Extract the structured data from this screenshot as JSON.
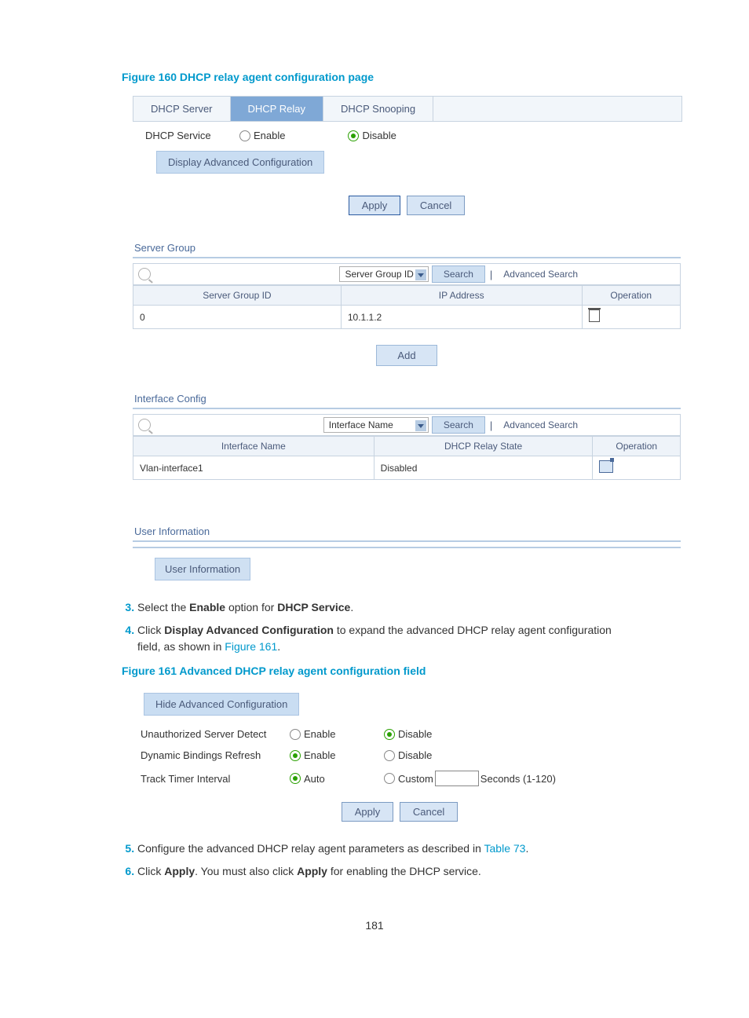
{
  "figure160_caption": "Figure 160 DHCP relay agent configuration page",
  "tabs": {
    "server": "DHCP Server",
    "relay": "DHCP Relay",
    "snooping": "DHCP Snooping"
  },
  "service": {
    "label": "DHCP Service",
    "enable": "Enable",
    "disable": "Disable"
  },
  "display_adv_btn": "Display Advanced Configuration",
  "apply": "Apply",
  "cancel": "Cancel",
  "server_group": {
    "title": "Server Group",
    "dropdown": "Server Group ID",
    "search": "Search",
    "advanced": "Advanced Search",
    "cols": {
      "id": "Server Group ID",
      "ip": "IP Address",
      "op": "Operation"
    },
    "rows": [
      {
        "id": "0",
        "ip": "10.1.1.2"
      }
    ],
    "add": "Add"
  },
  "interface_config": {
    "title": "Interface Config",
    "dropdown": "Interface Name",
    "search": "Search",
    "advanced": "Advanced Search",
    "cols": {
      "name": "Interface Name",
      "state": "DHCP Relay State",
      "op": "Operation"
    },
    "rows": [
      {
        "name": "Vlan-interface1",
        "state": "Disabled"
      }
    ]
  },
  "user_info": {
    "title": "User Information",
    "button": "User Information"
  },
  "step3_a": "Select the ",
  "step3_b": "Enable",
  "step3_c": " option for ",
  "step3_d": "DHCP Service",
  "step3_e": ".",
  "step4_a": "Click ",
  "step4_b": "Display Advanced Configuration",
  "step4_c": " to expand the advanced DHCP relay agent configuration field, as shown in ",
  "step4_link": "Figure 161",
  "step4_d": ".",
  "figure161_caption": "Figure 161 Advanced DHCP relay agent configuration field",
  "fig161": {
    "hide_btn": "Hide Advanced Configuration",
    "unauth": "Unauthorized Server Detect",
    "dynbind": "Dynamic Bindings Refresh",
    "track": "Track Timer Interval",
    "enable": "Enable",
    "disable": "Disable",
    "auto": "Auto",
    "custom": "Custom",
    "seconds": "Seconds (1-120)"
  },
  "step5_a": "Configure the advanced DHCP relay agent parameters as described in ",
  "step5_link": "Table 73",
  "step5_b": ".",
  "step6_a": "Click ",
  "step6_b": "Apply",
  "step6_c": ". You must also click ",
  "step6_d": "Apply",
  "step6_e": " for enabling the DHCP service.",
  "page_number": "181"
}
